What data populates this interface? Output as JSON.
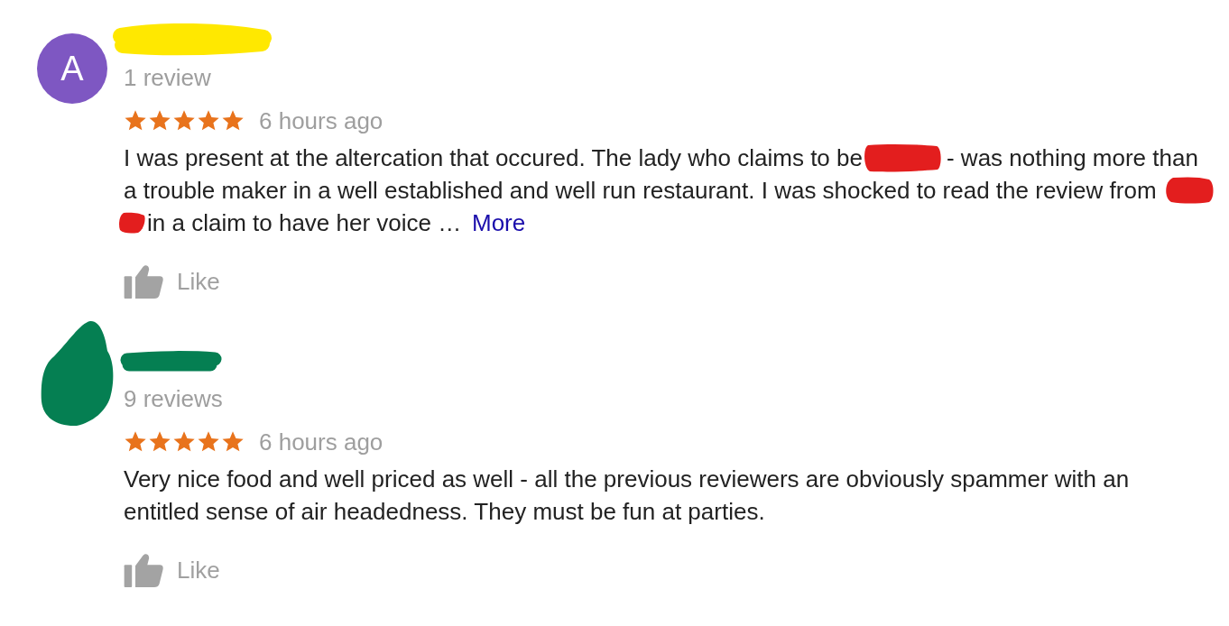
{
  "reviews": [
    {
      "avatar": {
        "kind": "letter",
        "letter": "A",
        "color": "#7e57c2"
      },
      "name": {
        "kind": "streak",
        "color": "#ffe800"
      },
      "review_count": "1 review",
      "stars": 5,
      "time": "6 hours ago",
      "lines": [
        [
          {
            "kind": "text",
            "text": "I was present at the altercation that occured. The lady who claims to be"
          },
          {
            "kind": "scrawl",
            "color": "#e31e1e"
          },
          {
            "kind": "text",
            "text": "- was nothing more than"
          }
        ],
        [
          {
            "kind": "text",
            "text": "a trouble maker in a well established and well run restaurant. I was shocked to read the review from"
          },
          {
            "kind": "blot",
            "color": "#e31e1e"
          }
        ],
        [
          {
            "kind": "dab",
            "color": "#e31e1e"
          },
          {
            "kind": "text",
            "text": "in a claim to have her voice …"
          },
          {
            "kind": "link",
            "text": "More"
          }
        ]
      ],
      "like": "Like"
    },
    {
      "avatar": {
        "kind": "scribble",
        "color": "#057f52"
      },
      "name": {
        "kind": "stripe",
        "color": "#057f52"
      },
      "review_count": "9 reviews",
      "stars": 5,
      "time": "6 hours ago",
      "lines": [
        [
          {
            "kind": "text",
            "text": "Very nice food and well priced as well - all the previous reviewers are obviously spammer with an"
          }
        ],
        [
          {
            "kind": "text",
            "text": "entitled sense of air headedness. They must be fun at parties."
          }
        ]
      ],
      "like": "Like"
    }
  ]
}
